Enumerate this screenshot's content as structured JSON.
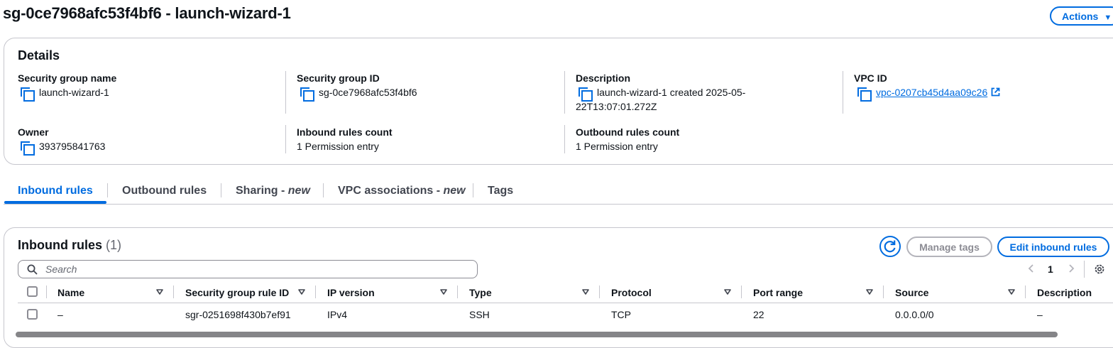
{
  "header": {
    "title": "sg-0ce7968afc53f4bf6 - launch-wizard-1",
    "actions_label": "Actions"
  },
  "details": {
    "title": "Details",
    "fields": {
      "sg_name": {
        "label": "Security group name",
        "value": "launch-wizard-1"
      },
      "sg_id": {
        "label": "Security group ID",
        "value": "sg-0ce7968afc53f4bf6"
      },
      "description": {
        "label": "Description",
        "value_line1": "launch-wizard-1 created 2025-05-",
        "value_line2": "22T13:07:01.272Z"
      },
      "vpc_id": {
        "label": "VPC ID",
        "value": "vpc-0207cb45d4aa09c26"
      },
      "owner": {
        "label": "Owner",
        "value": "393795841763"
      },
      "inbound_count": {
        "label": "Inbound rules count",
        "value": "1 Permission entry"
      },
      "outbound_count": {
        "label": "Outbound rules count",
        "value": "1 Permission entry"
      }
    }
  },
  "tabs": [
    {
      "label": "Inbound rules",
      "active": true
    },
    {
      "label": "Outbound rules"
    },
    {
      "label": "Sharing - ",
      "badge": "new"
    },
    {
      "label": "VPC associations - ",
      "badge": "new"
    },
    {
      "label": "Tags"
    }
  ],
  "inbound": {
    "title": "Inbound rules",
    "count": "(1)",
    "manage_tags_label": "Manage tags",
    "edit_label": "Edit inbound rules",
    "search_placeholder": "Search",
    "page": "1",
    "columns": [
      "Name",
      "Security group rule ID",
      "IP version",
      "Type",
      "Protocol",
      "Port range",
      "Source",
      "Description"
    ],
    "rows": [
      [
        "–",
        "sgr-0251698f430b7ef91",
        "IPv4",
        "SSH",
        "TCP",
        "22",
        "0.0.0.0/0",
        "–"
      ]
    ]
  },
  "colors": {
    "accent": "#006ce0",
    "text": "#0f141a",
    "border": "#c6c6cd",
    "disabled": "#8c8c94"
  },
  "icons": [
    "copy-icon",
    "external-link-icon",
    "refresh-icon",
    "search-icon",
    "chevron-left-icon",
    "chevron-right-icon",
    "settings-icon",
    "sort-icon",
    "caret-down-icon"
  ]
}
